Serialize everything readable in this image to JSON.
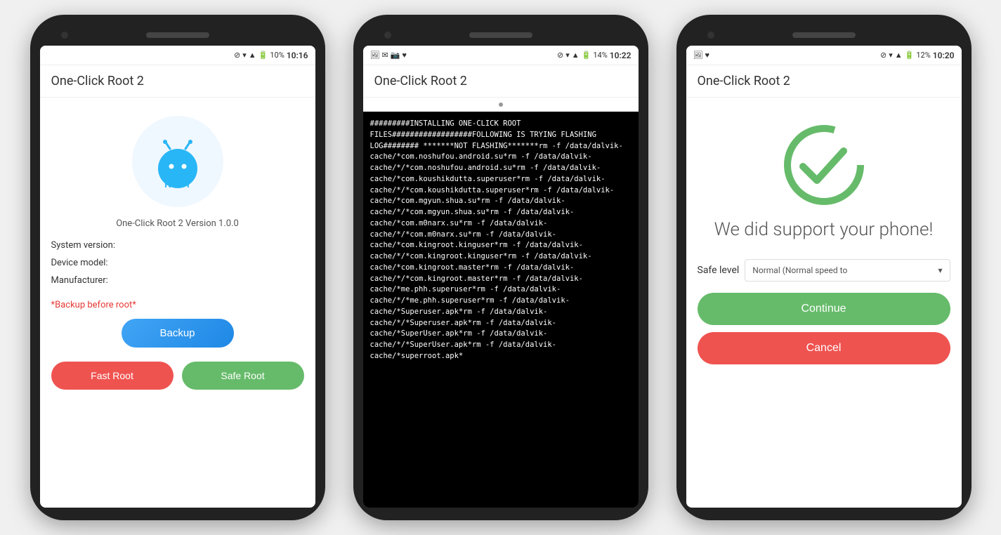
{
  "page": {
    "background": "#f0f0f0"
  },
  "phone1": {
    "status_bar": {
      "battery": "10%",
      "time": "10:16"
    },
    "app_title": "One-Click Root 2",
    "version_text": "One-Click Root 2 Version 1.0.0",
    "info_rows": [
      "System version:",
      "Device model:",
      "Manufacturer:"
    ],
    "backup_warning": "*Backup before root*",
    "backup_button": "Backup",
    "fast_root_button": "Fast Root",
    "safe_root_button": "Safe Root"
  },
  "phone2": {
    "status_bar": {
      "battery": "14%",
      "time": "10:22"
    },
    "app_title": "One-Click Root 2",
    "log_text": "#########INSTALLING ONE-CLICK ROOT FILES##################FOLLOWING IS TRYING FLASHING LOG######## *******NOT FLASHING*******rm -f /data/dalvik-cache/*com.noshufou.android.su*rm -f /data/dalvik-cache/*/*com.noshufou.android.su*rm -f /data/dalvik-cache/*com.koushikdutta.superuser*rm -f /data/dalvik-cache/*/*com.koushikdutta.superuser*rm -f /data/dalvik-cache/*com.mgyun.shua.su*rm -f /data/dalvik-cache/*/*com.mgyun.shua.su*rm -f /data/dalvik-cache/*com.m0narx.su*rm -f /data/dalvik-cache/*/*com.m0narx.su*rm -f /data/dalvik-cache/*com.kingroot.kinguser*rm -f /data/dalvik-cache/*/*com.kingroot.kinguser*rm -f /data/dalvik-cache/*com.kingroot.master*rm -f /data/dalvik-cache/*/*com.kingroot.master*rm -f /data/dalvik-cache/*me.phh.superuser*rm -f /data/dalvik-cache/*/*me.phh.superuser*rm -f /data/dalvik-cache/*Superuser.apk*rm -f /data/dalvik-cache/*/*Superuser.apk*rm -f /data/dalvik-cache/*SuperUser.apk*rm -f /data/dalvik-cache/*/*SuperUser.apk*rm -f /data/dalvik-cache/*superroot.apk*"
  },
  "phone3": {
    "status_bar": {
      "battery": "12%",
      "time": "10:20"
    },
    "app_title": "One-Click Root 2",
    "success_message": "We did support your phone!",
    "safe_level_label": "Safe level",
    "safe_level_value": "Normal (Normal speed to",
    "continue_button": "Continue",
    "cancel_button": "Cancel"
  }
}
